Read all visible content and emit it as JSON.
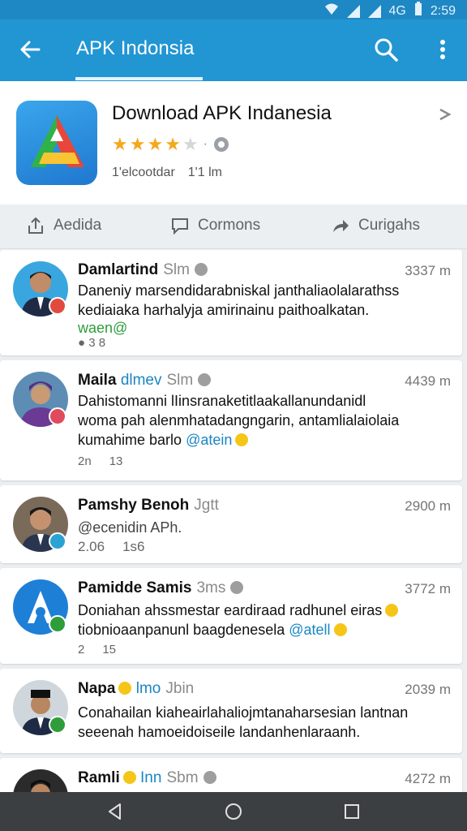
{
  "status_bar": {
    "time": "2:59",
    "network": "4G"
  },
  "app_bar": {
    "title": "APK Indonsia"
  },
  "app": {
    "name": "Download APK Indanesia",
    "rating_stars": 3.5,
    "developer": "1'elcootdar",
    "downloads": "1'1 lm"
  },
  "actions": {
    "left": "Aedida",
    "middle": "Cormons",
    "right": "Curigahs"
  },
  "posts": [
    {
      "name": "Damlartind",
      "tag": "Slm",
      "time": "3337 m",
      "line1": "Daneniy marsendidarabniskal janthaliaolalarathss",
      "line2": "kediaiaka harhalyja amirinainu paithoalkatan.",
      "line3": "waen@",
      "stats": [
        "● 3 8"
      ],
      "badge_color": "#e14a3c"
    },
    {
      "name": "Maila",
      "name_hl": "dlmev",
      "tag": "Slm",
      "time": "4439 m",
      "line1": "Dahistomanni lIinsranaketitlaakallanundanidl",
      "line2": "woma pah alenmhatadangngarin, antamlialaiolaia",
      "line3": "kumahime barlo",
      "line3_link": "@atein",
      "stats": [
        "2n",
        "13"
      ],
      "badge_color": "#e14a5c"
    },
    {
      "name": "Pamshy Benoh",
      "tag": "Jgtt",
      "time": "2900 m",
      "line1": "@ecenidin APh.",
      "stats": [
        "2.06",
        "1s6"
      ],
      "badge_color": "#2aa3d4"
    },
    {
      "name": "Pamidde Samis",
      "tag": "3ms",
      "time": "3772 m",
      "line1": "Doniahan ahssmestar eardiraad radhunel eiras",
      "line2": "tiobnioaanpanunl baagdenesela",
      "line2_link": "@atell",
      "stats": [
        "2",
        "15"
      ],
      "badge_color": "#2e9d3a"
    },
    {
      "name": "Napa",
      "name_hl": "lmo",
      "tag": "Jbin",
      "time": "2039 m",
      "line1": "Conahailan kiaheairlahaliojmtanaharsesian lantnan",
      "line2": "seeenah hamoeidoiseile landanhenlaraanh.",
      "badge_color": "#2e9d3a"
    },
    {
      "name": "Ramli",
      "name_hl": "Inn",
      "tag": "Sbm",
      "time": "4272 m",
      "badge_color": "#2aa3d4"
    }
  ],
  "colors": {
    "app_bar": "#2196d3",
    "accent": "#1a86c4",
    "star": "#f4a81d"
  }
}
